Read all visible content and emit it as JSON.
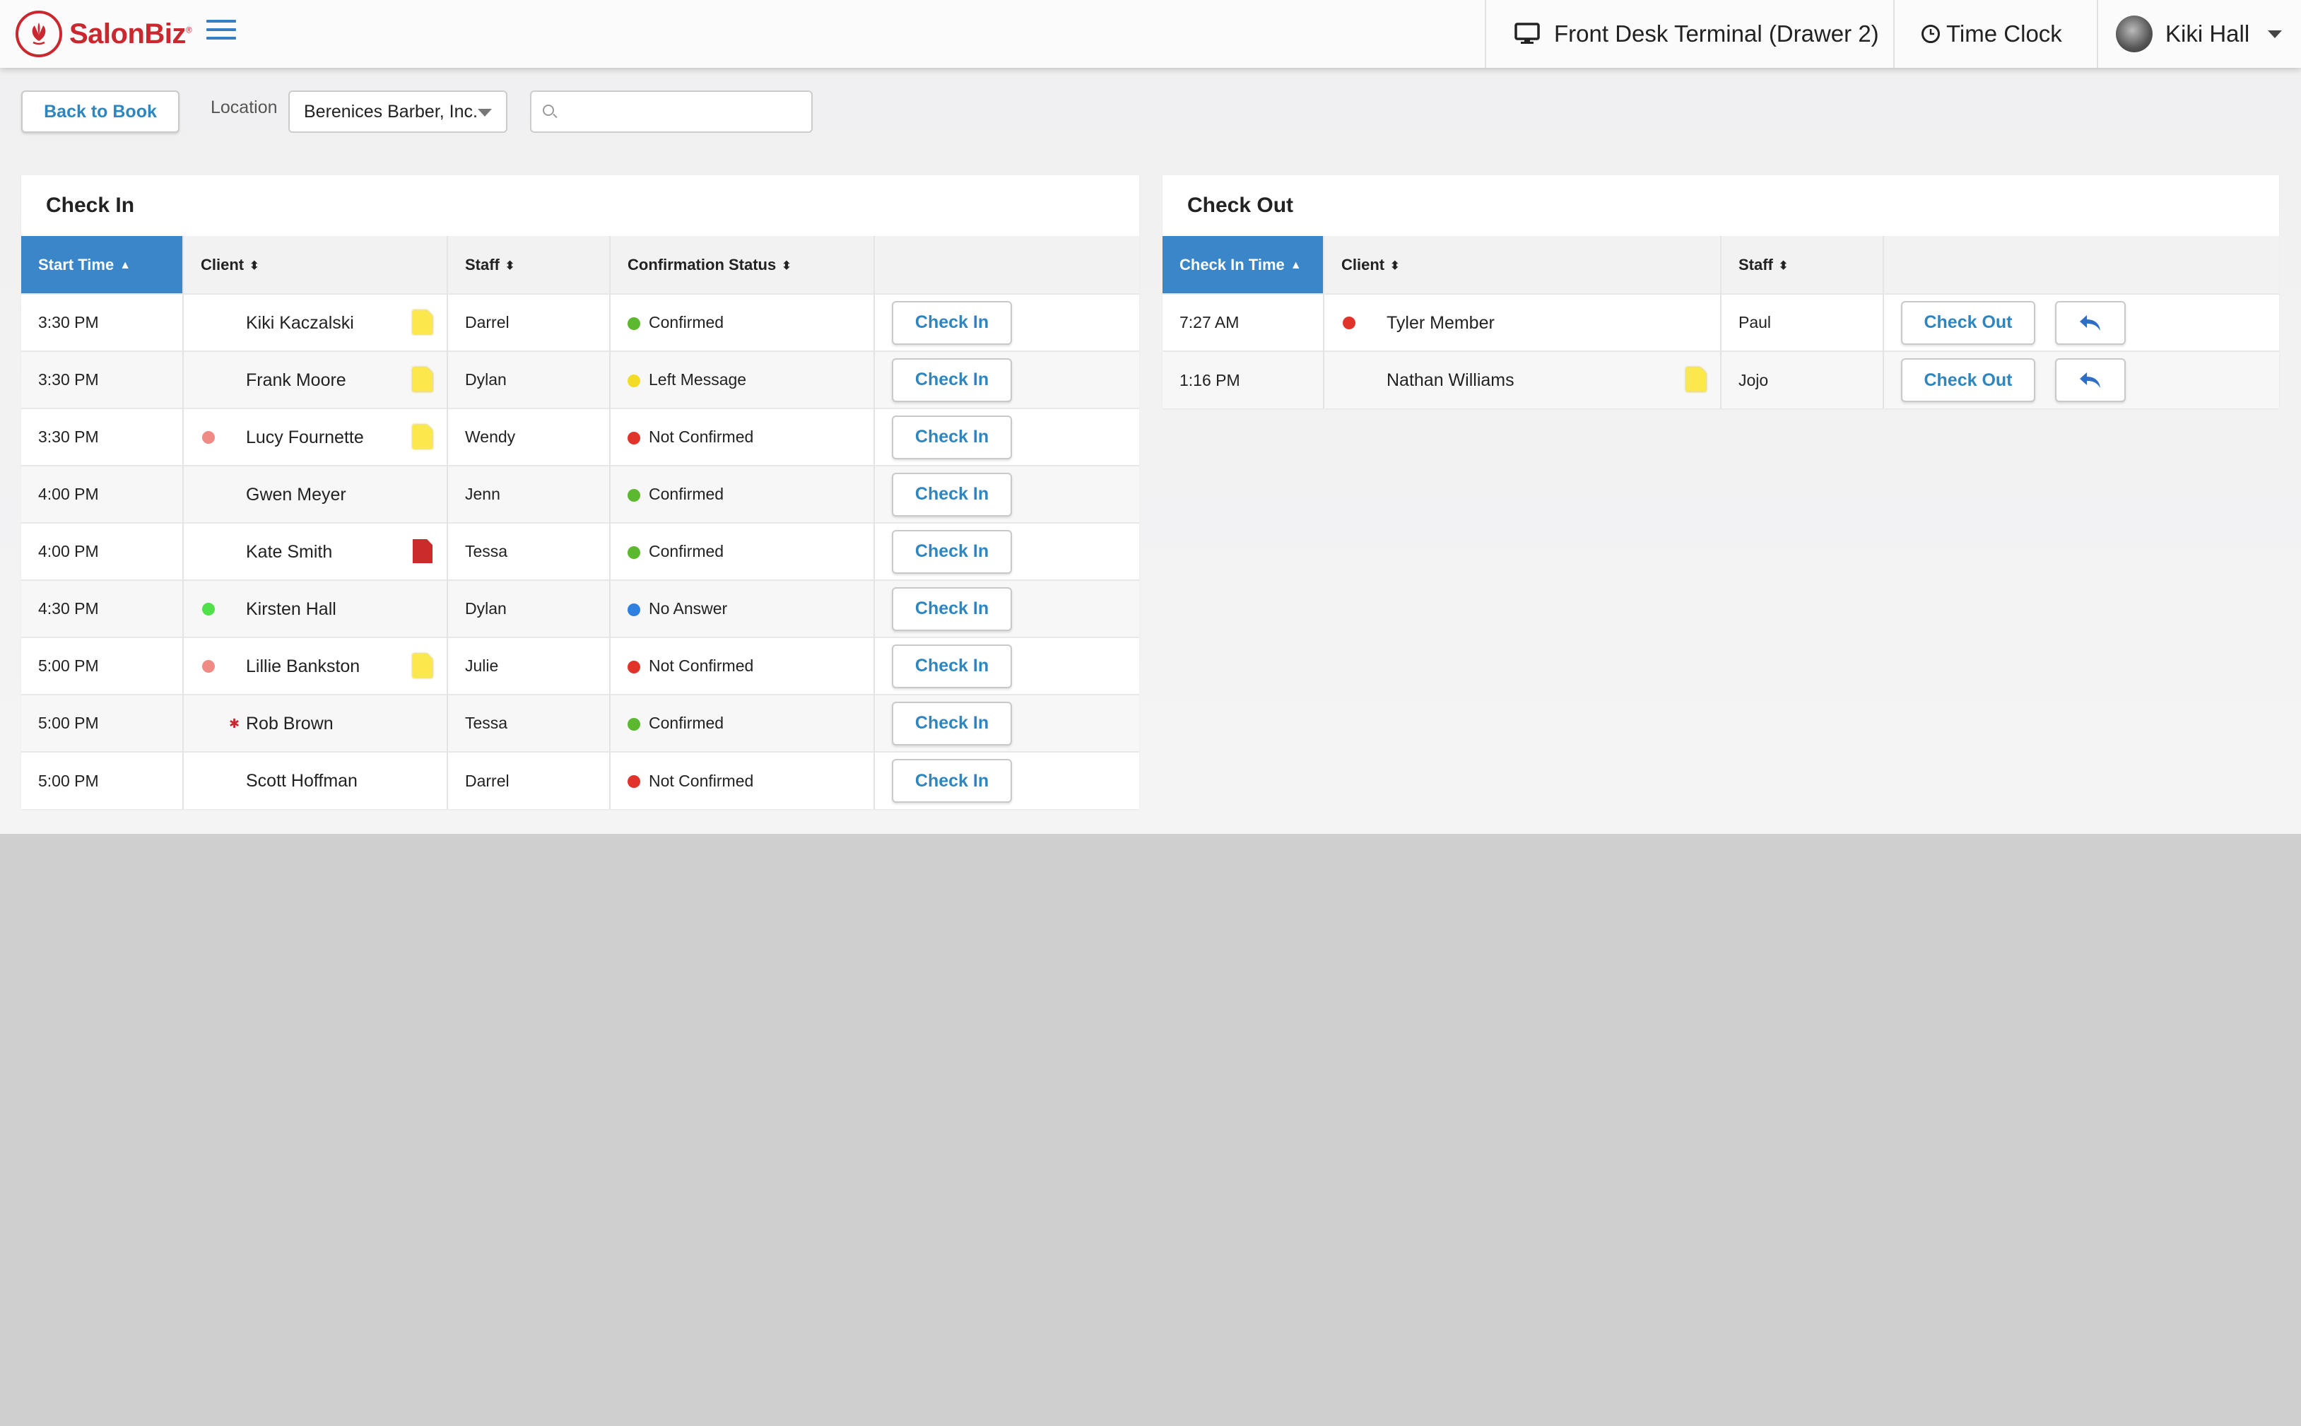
{
  "app": {
    "brand": "SalonBiz",
    "brand_mark": "®"
  },
  "topbar": {
    "terminal_label": "Front Desk Terminal (Drawer 2)",
    "time_clock_label": "Time Clock",
    "user_name": "Kiki Hall"
  },
  "toolbar": {
    "back_label": "Back to Book",
    "location_label": "Location",
    "location_value": "Berenices Barber, Inc.",
    "search_value": ""
  },
  "colors": {
    "confirmed": "#5cb82e",
    "left_message": "#f2dc27",
    "not_confirmed": "#e0342b",
    "no_answer": "#2f7fe0",
    "accent": "#3a86c8",
    "brand": "#c8282e"
  },
  "checkin": {
    "title": "Check In",
    "columns": [
      "Start Time",
      "Client",
      "Staff",
      "Confirmation Status"
    ],
    "button_label": "Check In",
    "rows": [
      {
        "time": "3:30 PM",
        "client": "Kiki Kaczalski",
        "staff": "Darrel",
        "status": "Confirmed",
        "status_color": "#5cb82e",
        "marker": null,
        "note": "yellow"
      },
      {
        "time": "3:30 PM",
        "client": "Frank Moore",
        "staff": "Dylan",
        "status": "Left Message",
        "status_color": "#f2dc27",
        "marker": null,
        "note": "yellow"
      },
      {
        "time": "3:30 PM",
        "client": "Lucy Fournette",
        "staff": "Wendy",
        "status": "Not Confirmed",
        "status_color": "#e0342b",
        "marker": "#f08a84",
        "note": "yellow"
      },
      {
        "time": "4:00 PM",
        "client": "Gwen Meyer",
        "staff": "Jenn",
        "status": "Confirmed",
        "status_color": "#5cb82e",
        "marker": null,
        "note": null
      },
      {
        "time": "4:00 PM",
        "client": "Kate Smith",
        "staff": "Tessa",
        "status": "Confirmed",
        "status_color": "#5cb82e",
        "marker": null,
        "note": "red"
      },
      {
        "time": "4:30 PM",
        "client": "Kirsten Hall",
        "staff": "Dylan",
        "status": "No Answer",
        "status_color": "#2f7fe0",
        "marker": "#4fe04a",
        "note": null
      },
      {
        "time": "5:00 PM",
        "client": "Lillie Bankston",
        "staff": "Julie",
        "status": "Not Confirmed",
        "status_color": "#e0342b",
        "marker": "#f08a84",
        "note": "yellow"
      },
      {
        "time": "5:00 PM",
        "client": "Rob Brown",
        "staff": "Tessa",
        "status": "Confirmed",
        "status_color": "#5cb82e",
        "marker": "star",
        "note": null
      },
      {
        "time": "5:00 PM",
        "client": "Scott Hoffman",
        "staff": "Darrel",
        "status": "Not Confirmed",
        "status_color": "#e0342b",
        "marker": null,
        "note": null
      }
    ]
  },
  "checkout": {
    "title": "Check Out",
    "columns": [
      "Check In Time",
      "Client",
      "Staff"
    ],
    "button_label": "Check Out",
    "rows": [
      {
        "time": "7:27 AM",
        "client": "Tyler Member",
        "staff": "Paul",
        "marker": "#e0342b",
        "note": null
      },
      {
        "time": "1:16 PM",
        "client": "Nathan Williams",
        "staff": "Jojo",
        "marker": null,
        "note": "yellow"
      }
    ]
  }
}
